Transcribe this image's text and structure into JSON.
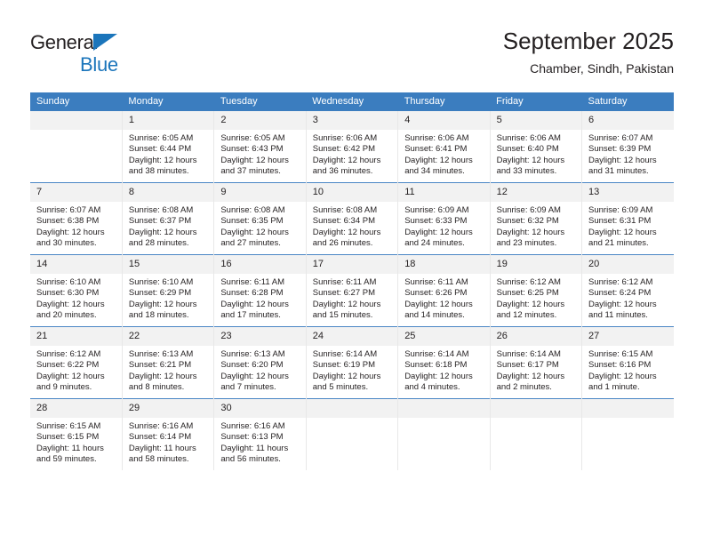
{
  "brand": {
    "name_part1": "General",
    "name_part2": "Blue",
    "triangle_color": "#1b75bb"
  },
  "header": {
    "title": "September 2025",
    "location": "Chamber, Sindh, Pakistan"
  },
  "theme": {
    "header_blue": "#3b7dbf",
    "separator_blue": "#4a86c5",
    "daynum_band": "#f2f2f2",
    "text": "#231f20"
  },
  "weekdays": [
    "Sunday",
    "Monday",
    "Tuesday",
    "Wednesday",
    "Thursday",
    "Friday",
    "Saturday"
  ],
  "labels": {
    "sunrise_prefix": "Sunrise:",
    "sunset_prefix": "Sunset:",
    "daylight_prefix": "Daylight:"
  },
  "weeks": [
    [
      {
        "day": "",
        "sunrise": "",
        "sunset": "",
        "daylight_line1": "",
        "daylight_line2": ""
      },
      {
        "day": "1",
        "sunrise": "Sunrise: 6:05 AM",
        "sunset": "Sunset: 6:44 PM",
        "daylight_line1": "Daylight: 12 hours",
        "daylight_line2": "and 38 minutes."
      },
      {
        "day": "2",
        "sunrise": "Sunrise: 6:05 AM",
        "sunset": "Sunset: 6:43 PM",
        "daylight_line1": "Daylight: 12 hours",
        "daylight_line2": "and 37 minutes."
      },
      {
        "day": "3",
        "sunrise": "Sunrise: 6:06 AM",
        "sunset": "Sunset: 6:42 PM",
        "daylight_line1": "Daylight: 12 hours",
        "daylight_line2": "and 36 minutes."
      },
      {
        "day": "4",
        "sunrise": "Sunrise: 6:06 AM",
        "sunset": "Sunset: 6:41 PM",
        "daylight_line1": "Daylight: 12 hours",
        "daylight_line2": "and 34 minutes."
      },
      {
        "day": "5",
        "sunrise": "Sunrise: 6:06 AM",
        "sunset": "Sunset: 6:40 PM",
        "daylight_line1": "Daylight: 12 hours",
        "daylight_line2": "and 33 minutes."
      },
      {
        "day": "6",
        "sunrise": "Sunrise: 6:07 AM",
        "sunset": "Sunset: 6:39 PM",
        "daylight_line1": "Daylight: 12 hours",
        "daylight_line2": "and 31 minutes."
      }
    ],
    [
      {
        "day": "7",
        "sunrise": "Sunrise: 6:07 AM",
        "sunset": "Sunset: 6:38 PM",
        "daylight_line1": "Daylight: 12 hours",
        "daylight_line2": "and 30 minutes."
      },
      {
        "day": "8",
        "sunrise": "Sunrise: 6:08 AM",
        "sunset": "Sunset: 6:37 PM",
        "daylight_line1": "Daylight: 12 hours",
        "daylight_line2": "and 28 minutes."
      },
      {
        "day": "9",
        "sunrise": "Sunrise: 6:08 AM",
        "sunset": "Sunset: 6:35 PM",
        "daylight_line1": "Daylight: 12 hours",
        "daylight_line2": "and 27 minutes."
      },
      {
        "day": "10",
        "sunrise": "Sunrise: 6:08 AM",
        "sunset": "Sunset: 6:34 PM",
        "daylight_line1": "Daylight: 12 hours",
        "daylight_line2": "and 26 minutes."
      },
      {
        "day": "11",
        "sunrise": "Sunrise: 6:09 AM",
        "sunset": "Sunset: 6:33 PM",
        "daylight_line1": "Daylight: 12 hours",
        "daylight_line2": "and 24 minutes."
      },
      {
        "day": "12",
        "sunrise": "Sunrise: 6:09 AM",
        "sunset": "Sunset: 6:32 PM",
        "daylight_line1": "Daylight: 12 hours",
        "daylight_line2": "and 23 minutes."
      },
      {
        "day": "13",
        "sunrise": "Sunrise: 6:09 AM",
        "sunset": "Sunset: 6:31 PM",
        "daylight_line1": "Daylight: 12 hours",
        "daylight_line2": "and 21 minutes."
      }
    ],
    [
      {
        "day": "14",
        "sunrise": "Sunrise: 6:10 AM",
        "sunset": "Sunset: 6:30 PM",
        "daylight_line1": "Daylight: 12 hours",
        "daylight_line2": "and 20 minutes."
      },
      {
        "day": "15",
        "sunrise": "Sunrise: 6:10 AM",
        "sunset": "Sunset: 6:29 PM",
        "daylight_line1": "Daylight: 12 hours",
        "daylight_line2": "and 18 minutes."
      },
      {
        "day": "16",
        "sunrise": "Sunrise: 6:11 AM",
        "sunset": "Sunset: 6:28 PM",
        "daylight_line1": "Daylight: 12 hours",
        "daylight_line2": "and 17 minutes."
      },
      {
        "day": "17",
        "sunrise": "Sunrise: 6:11 AM",
        "sunset": "Sunset: 6:27 PM",
        "daylight_line1": "Daylight: 12 hours",
        "daylight_line2": "and 15 minutes."
      },
      {
        "day": "18",
        "sunrise": "Sunrise: 6:11 AM",
        "sunset": "Sunset: 6:26 PM",
        "daylight_line1": "Daylight: 12 hours",
        "daylight_line2": "and 14 minutes."
      },
      {
        "day": "19",
        "sunrise": "Sunrise: 6:12 AM",
        "sunset": "Sunset: 6:25 PM",
        "daylight_line1": "Daylight: 12 hours",
        "daylight_line2": "and 12 minutes."
      },
      {
        "day": "20",
        "sunrise": "Sunrise: 6:12 AM",
        "sunset": "Sunset: 6:24 PM",
        "daylight_line1": "Daylight: 12 hours",
        "daylight_line2": "and 11 minutes."
      }
    ],
    [
      {
        "day": "21",
        "sunrise": "Sunrise: 6:12 AM",
        "sunset": "Sunset: 6:22 PM",
        "daylight_line1": "Daylight: 12 hours",
        "daylight_line2": "and 9 minutes."
      },
      {
        "day": "22",
        "sunrise": "Sunrise: 6:13 AM",
        "sunset": "Sunset: 6:21 PM",
        "daylight_line1": "Daylight: 12 hours",
        "daylight_line2": "and 8 minutes."
      },
      {
        "day": "23",
        "sunrise": "Sunrise: 6:13 AM",
        "sunset": "Sunset: 6:20 PM",
        "daylight_line1": "Daylight: 12 hours",
        "daylight_line2": "and 7 minutes."
      },
      {
        "day": "24",
        "sunrise": "Sunrise: 6:14 AM",
        "sunset": "Sunset: 6:19 PM",
        "daylight_line1": "Daylight: 12 hours",
        "daylight_line2": "and 5 minutes."
      },
      {
        "day": "25",
        "sunrise": "Sunrise: 6:14 AM",
        "sunset": "Sunset: 6:18 PM",
        "daylight_line1": "Daylight: 12 hours",
        "daylight_line2": "and 4 minutes."
      },
      {
        "day": "26",
        "sunrise": "Sunrise: 6:14 AM",
        "sunset": "Sunset: 6:17 PM",
        "daylight_line1": "Daylight: 12 hours",
        "daylight_line2": "and 2 minutes."
      },
      {
        "day": "27",
        "sunrise": "Sunrise: 6:15 AM",
        "sunset": "Sunset: 6:16 PM",
        "daylight_line1": "Daylight: 12 hours",
        "daylight_line2": "and 1 minute."
      }
    ],
    [
      {
        "day": "28",
        "sunrise": "Sunrise: 6:15 AM",
        "sunset": "Sunset: 6:15 PM",
        "daylight_line1": "Daylight: 11 hours",
        "daylight_line2": "and 59 minutes."
      },
      {
        "day": "29",
        "sunrise": "Sunrise: 6:16 AM",
        "sunset": "Sunset: 6:14 PM",
        "daylight_line1": "Daylight: 11 hours",
        "daylight_line2": "and 58 minutes."
      },
      {
        "day": "30",
        "sunrise": "Sunrise: 6:16 AM",
        "sunset": "Sunset: 6:13 PM",
        "daylight_line1": "Daylight: 11 hours",
        "daylight_line2": "and 56 minutes."
      },
      {
        "day": "",
        "sunrise": "",
        "sunset": "",
        "daylight_line1": "",
        "daylight_line2": ""
      },
      {
        "day": "",
        "sunrise": "",
        "sunset": "",
        "daylight_line1": "",
        "daylight_line2": ""
      },
      {
        "day": "",
        "sunrise": "",
        "sunset": "",
        "daylight_line1": "",
        "daylight_line2": ""
      },
      {
        "day": "",
        "sunrise": "",
        "sunset": "",
        "daylight_line1": "",
        "daylight_line2": ""
      }
    ]
  ]
}
